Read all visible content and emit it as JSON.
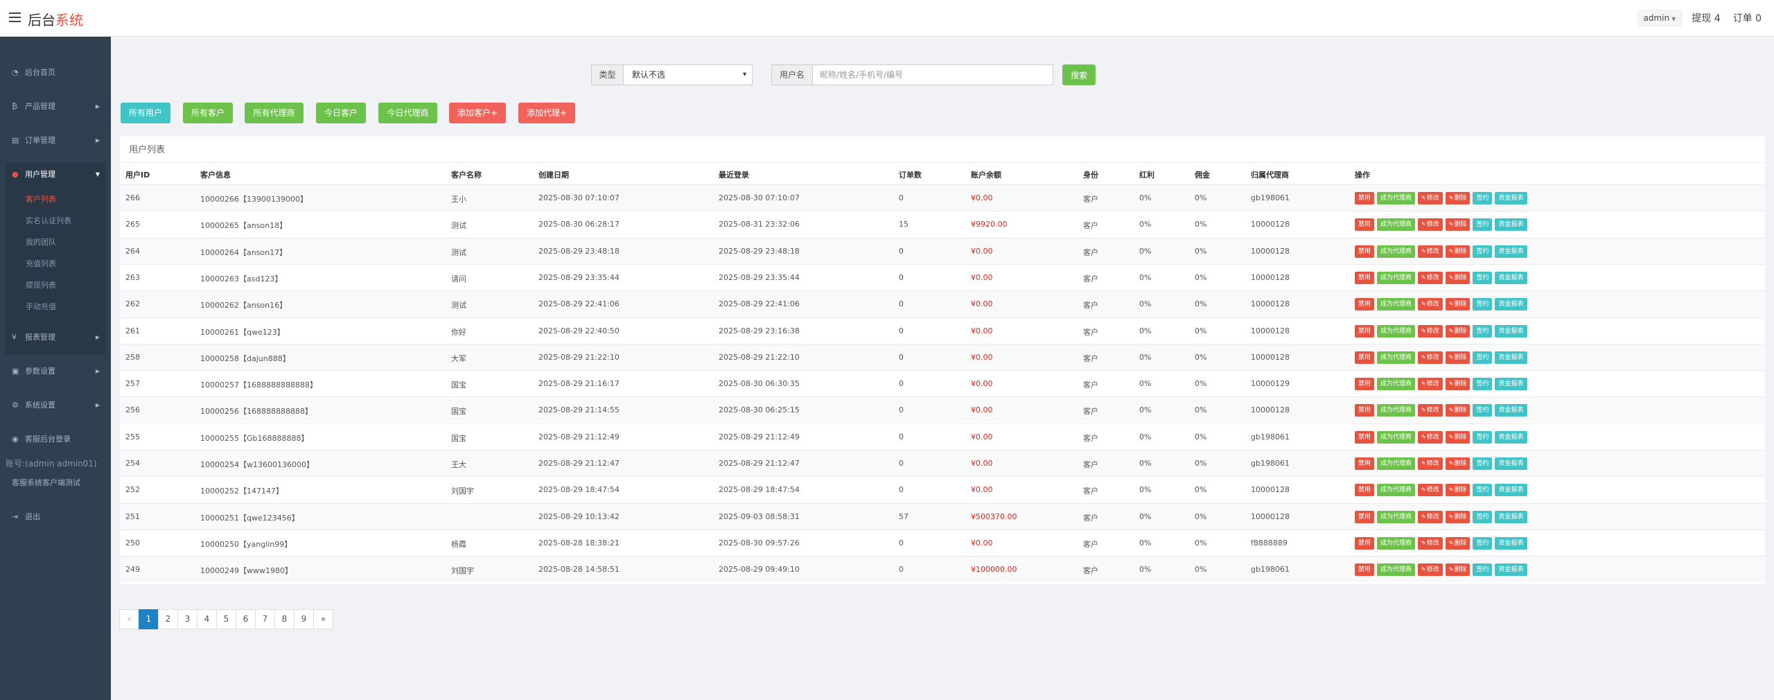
{
  "header": {
    "brand_main": "后台",
    "brand_accent": "系统",
    "admin_label": "admin",
    "withdraw_label": "提现 4",
    "order_label": "订单 0"
  },
  "sidebar": {
    "items": [
      {
        "label": "后台首页",
        "icon": "dashboard-icon",
        "glyph": "◔",
        "arrow": ""
      },
      {
        "label": "产品管理",
        "icon": "bitcoin-icon",
        "glyph": "₿",
        "arrow": "▶"
      },
      {
        "label": "订单管理",
        "icon": "clipboard-icon",
        "glyph": "▤",
        "arrow": "▶"
      },
      {
        "label": "用户管理",
        "icon": "user-icon",
        "glyph": "●",
        "arrow": "▼"
      },
      {
        "label": "报表管理",
        "icon": "yen-icon",
        "glyph": "¥",
        "arrow": "▶"
      },
      {
        "label": "参数设置",
        "icon": "copy-icon",
        "glyph": "▣",
        "arrow": "▶"
      },
      {
        "label": "系统设置",
        "icon": "cogs-icon",
        "glyph": "⚙",
        "arrow": "▶"
      },
      {
        "label": "客服后台登录",
        "icon": "user-circle-icon",
        "glyph": "◉",
        "arrow": ""
      },
      {
        "label": "客服系统客户端测试",
        "icon": "",
        "glyph": "",
        "arrow": ""
      },
      {
        "label": "退出",
        "icon": "signout-icon",
        "glyph": "⇥",
        "arrow": ""
      }
    ],
    "sub_items": [
      "客户列表",
      "实名认证列表",
      "我的团队",
      "充值列表",
      "提现列表",
      "手动充值"
    ],
    "account_text": "账号:(admin admin01)"
  },
  "filter": {
    "type_label": "类型",
    "type_value": "默认不选",
    "user_label": "用户名",
    "user_placeholder": "昵称/姓名/手机号/编号",
    "search_label": "搜索"
  },
  "actions": [
    "所有用户",
    "所有客户",
    "所有代理商",
    "今日客户",
    "今日代理商",
    "添加客户+",
    "添加代理+"
  ],
  "table": {
    "title": "用户列表",
    "headers": [
      "用户ID",
      "客户信息",
      "客户名称",
      "创建日期",
      "最近登录",
      "订单数",
      "账户余额",
      "身份",
      "红利",
      "佣金",
      "归属代理商",
      "操作"
    ],
    "op_labels": [
      "禁用",
      "成为代理商",
      "修改",
      "删除",
      "签约",
      "资金报表"
    ],
    "rows": [
      [
        "266",
        "10000266【13900139000】",
        "王小",
        "2025-08-30 07:10:07",
        "2025-08-30 07:10:07",
        "0",
        "¥0.00",
        "客户",
        "0%",
        "0%",
        "gb198061"
      ],
      [
        "265",
        "10000265【anson18】",
        "测试",
        "2025-08-30 06:28:17",
        "2025-08-31 23:32:06",
        "15",
        "¥9920.00",
        "客户",
        "0%",
        "0%",
        "10000128"
      ],
      [
        "264",
        "10000264【anson17】",
        "测试",
        "2025-08-29 23:48:18",
        "2025-08-29 23:48:18",
        "0",
        "¥0.00",
        "客户",
        "0%",
        "0%",
        "10000128"
      ],
      [
        "263",
        "10000263【asd123】",
        "请问",
        "2025-08-29 23:35:44",
        "2025-08-29 23:35:44",
        "0",
        "¥0.00",
        "客户",
        "0%",
        "0%",
        "10000128"
      ],
      [
        "262",
        "10000262【anson16】",
        "测试",
        "2025-08-29 22:41:06",
        "2025-08-29 22:41:06",
        "0",
        "¥0.00",
        "客户",
        "0%",
        "0%",
        "10000128"
      ],
      [
        "261",
        "10000261【qwe123】",
        "你好",
        "2025-08-29 22:40:50",
        "2025-08-29 23:16:38",
        "0",
        "¥0.00",
        "客户",
        "0%",
        "0%",
        "10000128"
      ],
      [
        "258",
        "10000258【dajun888】",
        "大军",
        "2025-08-29 21:22:10",
        "2025-08-29 21:22:10",
        "0",
        "¥0.00",
        "客户",
        "0%",
        "0%",
        "10000128"
      ],
      [
        "257",
        "10000257【1688888888888】",
        "国宝",
        "2025-08-29 21:16:17",
        "2025-08-30 06:30:35",
        "0",
        "¥0.00",
        "客户",
        "0%",
        "0%",
        "10000129"
      ],
      [
        "256",
        "10000256【168888888888】",
        "国宝",
        "2025-08-29 21:14:55",
        "2025-08-30 06:25:15",
        "0",
        "¥0.00",
        "客户",
        "0%",
        "0%",
        "10000128"
      ],
      [
        "255",
        "10000255【Gb168888888】",
        "国宝",
        "2025-08-29 21:12:49",
        "2025-08-29 21:12:49",
        "0",
        "¥0.00",
        "客户",
        "0%",
        "0%",
        "gb198061"
      ],
      [
        "254",
        "10000254【w13600136000】",
        "王大",
        "2025-08-29 21:12:47",
        "2025-08-29 21:12:47",
        "0",
        "¥0.00",
        "客户",
        "0%",
        "0%",
        "gb198061"
      ],
      [
        "252",
        "10000252【147147】",
        "刘国宇",
        "2025-08-29 18:47:54",
        "2025-08-29 18:47:54",
        "0",
        "¥0.00",
        "客户",
        "0%",
        "0%",
        "10000128"
      ],
      [
        "251",
        "10000251【qwe123456】",
        "",
        "2025-08-29 10:13:42",
        "2025-09-03 08:58:31",
        "57",
        "¥500370.00",
        "客户",
        "0%",
        "0%",
        "10000128"
      ],
      [
        "250",
        "10000250【yanglin99】",
        "杨霞",
        "2025-08-28 18:38:21",
        "2025-08-30 09:57:26",
        "0",
        "¥0.00",
        "客户",
        "0%",
        "0%",
        "f8888889"
      ],
      [
        "249",
        "10000249【www1980】",
        "刘国宇",
        "2025-08-28 14:58:51",
        "2025-08-29 09:49:10",
        "0",
        "¥100000.00",
        "客户",
        "0%",
        "0%",
        "gb198061"
      ]
    ]
  },
  "pagination": {
    "prev": "«",
    "pages": [
      "1",
      "2",
      "3",
      "4",
      "5",
      "6",
      "7",
      "8",
      "9"
    ],
    "next": "»",
    "current": "1"
  }
}
